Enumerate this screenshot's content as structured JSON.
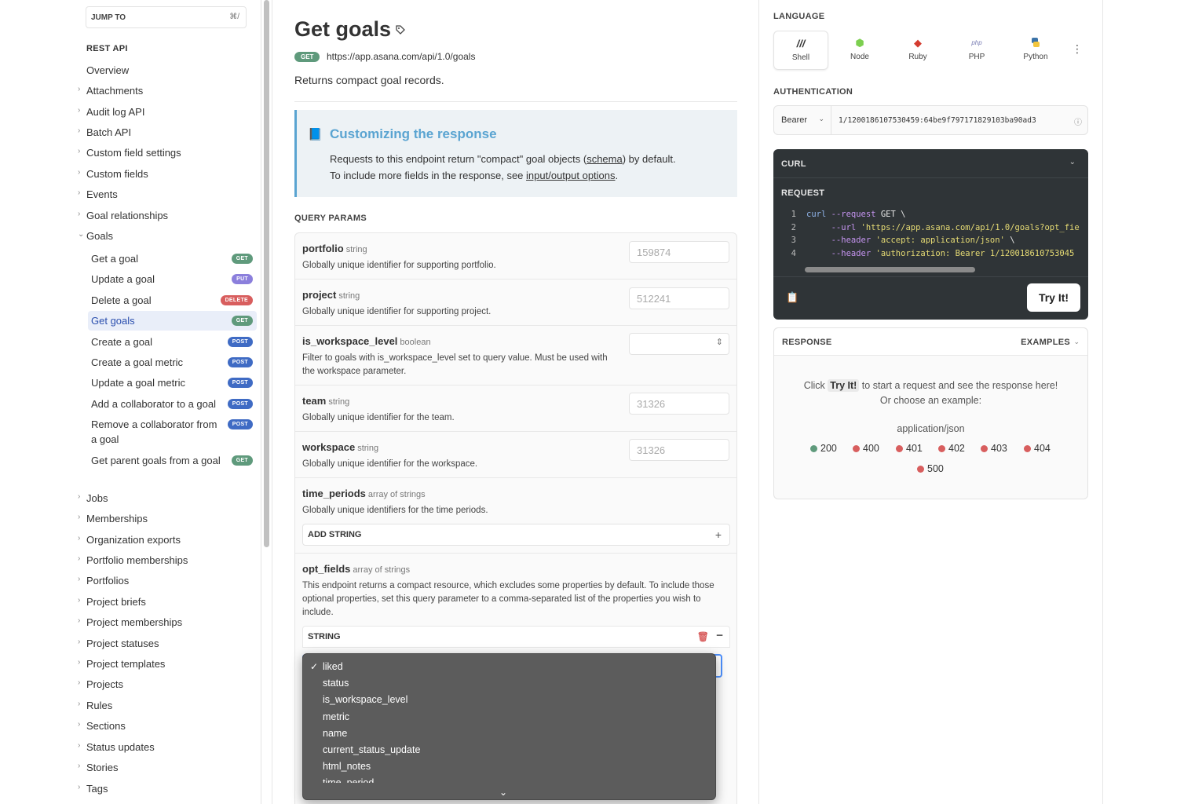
{
  "sidebar": {
    "jump_label": "JUMP TO",
    "jump_shortcut": "⌘/",
    "section_title": "REST API",
    "items_top": [
      "Overview",
      "Attachments",
      "Audit log API",
      "Batch API",
      "Custom field settings",
      "Custom fields",
      "Events",
      "Goal relationships",
      "Goals"
    ],
    "goals_children": [
      {
        "label": "Get a goal",
        "method": "GET"
      },
      {
        "label": "Update a goal",
        "method": "PUT"
      },
      {
        "label": "Delete a goal",
        "method": "DELETE"
      },
      {
        "label": "Get goals",
        "method": "GET",
        "active": true
      },
      {
        "label": "Create a goal",
        "method": "POST"
      },
      {
        "label": "Create a goal metric",
        "method": "POST"
      },
      {
        "label": "Update a goal metric",
        "method": "POST"
      },
      {
        "label": "Add a collaborator to a goal",
        "method": "POST"
      },
      {
        "label": "Remove a collaborator from a goal",
        "method": "POST"
      },
      {
        "label": "Get parent goals from a goal",
        "method": "GET"
      }
    ],
    "items_bottom": [
      "Jobs",
      "Memberships",
      "Organization exports",
      "Portfolio memberships",
      "Portfolios",
      "Project briefs",
      "Project memberships",
      "Project statuses",
      "Project templates",
      "Projects",
      "Rules",
      "Sections",
      "Status updates",
      "Stories",
      "Tags"
    ]
  },
  "main": {
    "title": "Get goals",
    "method": "GET",
    "url": "https://app.asana.com/api/1.0/goals",
    "description": "Returns compact goal records.",
    "callout": {
      "title": "Customizing the response",
      "line1_pre": "Requests to this endpoint return \"compact\" goal objects (",
      "line1_link": "schema",
      "line1_post": ") by default.",
      "line2_pre": "To include more fields in the response, see ",
      "line2_link": "input/output options",
      "line2_post": "."
    },
    "query_params_title": "QUERY PARAMS",
    "params": {
      "portfolio": {
        "name": "portfolio",
        "type": "string",
        "desc": "Globally unique identifier for supporting portfolio.",
        "placeholder": "159874"
      },
      "project": {
        "name": "project",
        "type": "string",
        "desc": "Globally unique identifier for supporting project.",
        "placeholder": "512241"
      },
      "is_workspace_level": {
        "name": "is_workspace_level",
        "type": "boolean",
        "desc": "Filter to goals with is_workspace_level set to query value. Must be used with the workspace parameter."
      },
      "team": {
        "name": "team",
        "type": "string",
        "desc": "Globally unique identifier for the team.",
        "placeholder": "31326"
      },
      "workspace": {
        "name": "workspace",
        "type": "string",
        "desc": "Globally unique identifier for the workspace.",
        "placeholder": "31326"
      },
      "time_periods": {
        "name": "time_periods",
        "type": "array of strings",
        "desc": "Globally unique identifiers for the time periods.",
        "add_label": "ADD STRING"
      },
      "opt_fields": {
        "name": "opt_fields",
        "type": "array of strings",
        "desc": "This endpoint returns a compact resource, which excludes some properties by default. To include those optional properties, set this query parameter to a comma-separated list of the properties you wish to include.",
        "string_label": "STRING"
      }
    },
    "dropdown": {
      "selected": "liked",
      "options": [
        "liked",
        "status",
        "is_workspace_level",
        "metric",
        "name",
        "current_status_update",
        "html_notes",
        "time_period"
      ]
    }
  },
  "right": {
    "language_title": "LANGUAGE",
    "languages": [
      "Shell",
      "Node",
      "Ruby",
      "PHP",
      "Python"
    ],
    "active_language": "Shell",
    "auth_title": "AUTHENTICATION",
    "auth_type": "Bearer",
    "auth_token": "1/1200186107530459:64be9f797171829103ba90ad3",
    "curl_title": "CURL",
    "request_title": "REQUEST",
    "try_label": "Try It!",
    "response_title": "RESPONSE",
    "examples_label": "EXAMPLES",
    "response_msg_pre": "Click ",
    "response_msg_code": "Try It!",
    "response_msg_post": " to start a request and see the response here!",
    "response_msg_line2": "Or choose an example:",
    "content_type": "application/json",
    "status_codes": [
      {
        "code": "200",
        "color": "#5f9a7c"
      },
      {
        "code": "400",
        "color": "#d85e5e"
      },
      {
        "code": "401",
        "color": "#d85e5e"
      },
      {
        "code": "402",
        "color": "#d85e5e"
      },
      {
        "code": "403",
        "color": "#d85e5e"
      },
      {
        "code": "404",
        "color": "#d85e5e"
      },
      {
        "code": "500",
        "color": "#d85e5e"
      }
    ]
  },
  "colors": {
    "get": "#5f9a7c",
    "put": "#8b7fdc",
    "delete": "#d85e5e",
    "post": "#3f6bc4",
    "accent": "#5aa4d1"
  }
}
